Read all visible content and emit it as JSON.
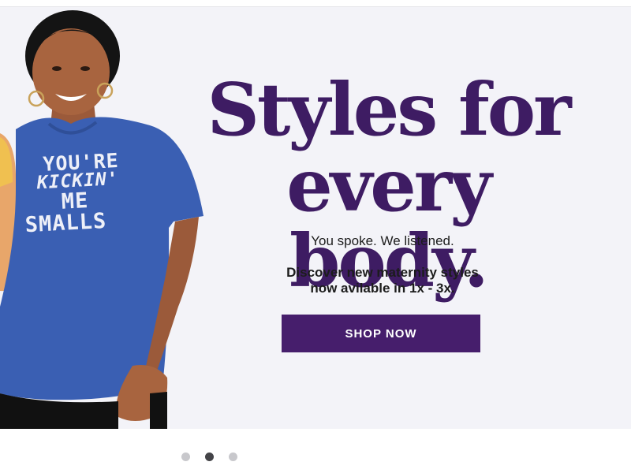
{
  "hero": {
    "headline_line1": "Styles for",
    "headline_line2": "every body.",
    "subline": "You spoke. We listened.",
    "body_line1": "Discover new maternity styles",
    "body_line2": "now avilable in 1x - 3x.",
    "cta_label": "SHOP NOW",
    "shirt_print": {
      "line1": "YOU'RE",
      "line2": "KICKIN'",
      "line3": "ME",
      "line4": "SMALLS"
    },
    "colors": {
      "brand_purple": "#3e1c63",
      "cta_background": "#461e6c",
      "background": "#f3f3f8",
      "shirt_blue": "#3a5fb3"
    }
  },
  "carousel": {
    "slide_count": 3,
    "active_index": 1
  }
}
